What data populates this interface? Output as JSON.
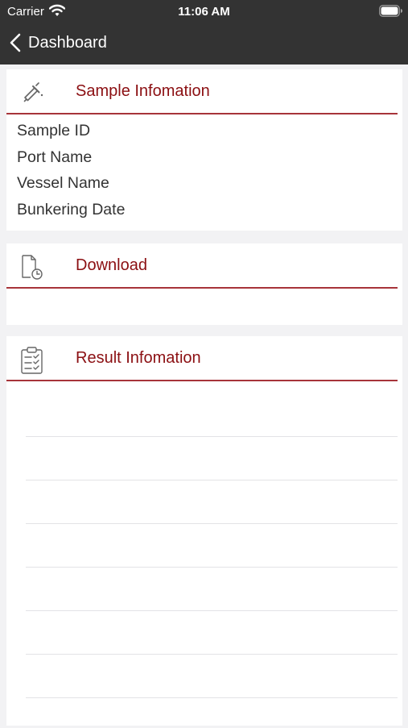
{
  "status_bar": {
    "carrier": "Carrier",
    "time": "11:06 AM"
  },
  "nav": {
    "back_label": "Dashboard"
  },
  "sections": {
    "sample": {
      "title": "Sample Infomation",
      "icon": "pipette-icon",
      "fields": [
        "Sample ID",
        "Port Name",
        "Vessel Name",
        "Bunkering Date"
      ]
    },
    "download": {
      "title": "Download",
      "icon": "document-clock-icon"
    },
    "result": {
      "title": "Result Infomation",
      "icon": "clipboard-checklist-icon",
      "rows": 7
    }
  },
  "colors": {
    "bar_background": "#333333",
    "accent_red": "#8b0f12",
    "rule_red": "#a7343a",
    "page_background": "#f2f2f4"
  }
}
